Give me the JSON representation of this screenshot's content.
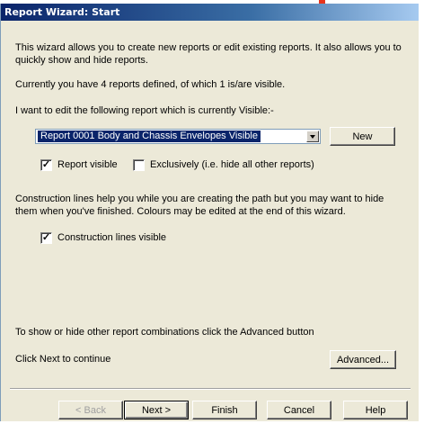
{
  "window": {
    "title": "Report Wizard: Start"
  },
  "intro_line1": "This wizard allows you to create new reports or edit existing reports.  It also allows you to",
  "intro_line2": "quickly show and hide reports.",
  "count_text": "Currently you have 4 reports defined, of which 1 is/are visible.",
  "edit_label": "I want to edit the following report which is currently  Visible:-",
  "report_select": {
    "value": "Report 0001 Body and Chassis Envelopes Visible"
  },
  "new_button": "New",
  "report_visible": {
    "label": "Report visible",
    "checked": true
  },
  "exclusively": {
    "label": "Exclusively (i.e. hide all other reports)",
    "checked": false
  },
  "construction_line1": "Construction lines help you while you are creating the path but you may want to hide",
  "construction_line2": "them when you've finished.  Colours may be edited at the end of this wizard.",
  "construction_visible": {
    "label": "Construction lines visible",
    "checked": true
  },
  "advanced_hint": "To show or hide other report combinations click the Advanced button",
  "next_hint": "Click Next to continue",
  "advanced_button": "Advanced...",
  "footer": {
    "back": "< Back",
    "next": "Next >",
    "finish": "Finish",
    "cancel": "Cancel",
    "help": "Help"
  },
  "colors": {
    "titlebar": "#0a246a",
    "dialog_bg": "#ece9d8",
    "selection": "#0a246a",
    "accent": "#e8341c"
  }
}
